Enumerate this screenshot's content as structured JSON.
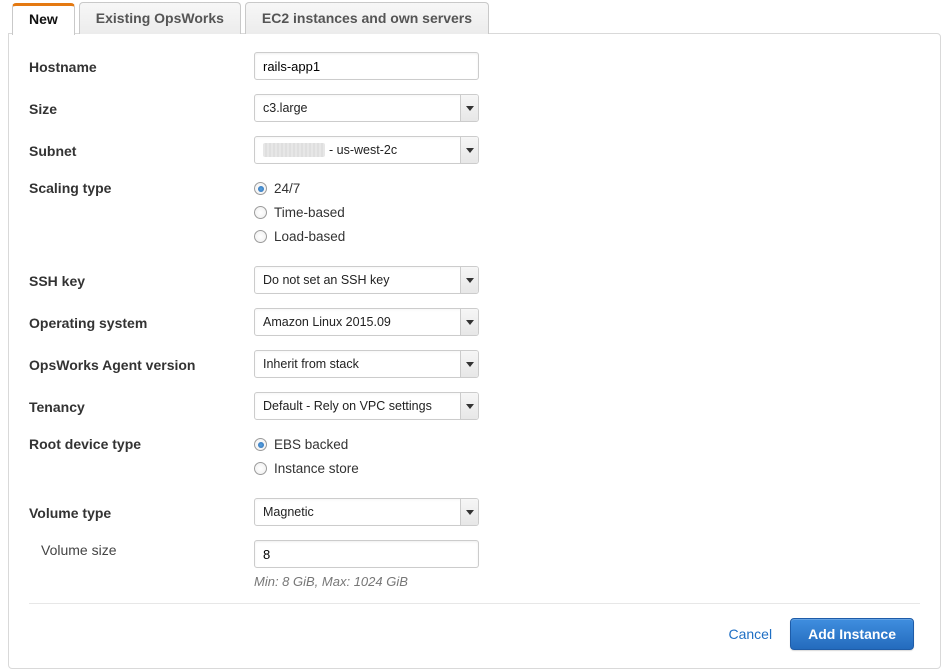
{
  "tabs": [
    {
      "label": "New",
      "active": true
    },
    {
      "label": "Existing OpsWorks",
      "active": false
    },
    {
      "label": "EC2 instances and own servers",
      "active": false
    }
  ],
  "form": {
    "hostname": {
      "label": "Hostname",
      "value": "rails-app1"
    },
    "size": {
      "label": "Size",
      "value": "c3.large"
    },
    "subnet": {
      "label": "Subnet",
      "value_suffix": "- us-west-2c"
    },
    "scaling_type": {
      "label": "Scaling type",
      "options": [
        {
          "label": "24/7",
          "checked": true
        },
        {
          "label": "Time-based",
          "checked": false
        },
        {
          "label": "Load-based",
          "checked": false
        }
      ]
    },
    "ssh_key": {
      "label": "SSH key",
      "value": "Do not set an SSH key"
    },
    "os": {
      "label": "Operating system",
      "value": "Amazon Linux 2015.09"
    },
    "agent": {
      "label": "OpsWorks Agent version",
      "value": "Inherit from stack"
    },
    "tenancy": {
      "label": "Tenancy",
      "value": "Default - Rely on VPC settings"
    },
    "root_device": {
      "label": "Root device type",
      "options": [
        {
          "label": "EBS backed",
          "checked": true
        },
        {
          "label": "Instance store",
          "checked": false
        }
      ]
    },
    "volume_type": {
      "label": "Volume type",
      "value": "Magnetic"
    },
    "volume_size": {
      "label": "Volume size",
      "value": "8",
      "hint": "Min: 8 GiB, Max: 1024 GiB"
    }
  },
  "buttons": {
    "cancel": "Cancel",
    "submit": "Add Instance"
  }
}
